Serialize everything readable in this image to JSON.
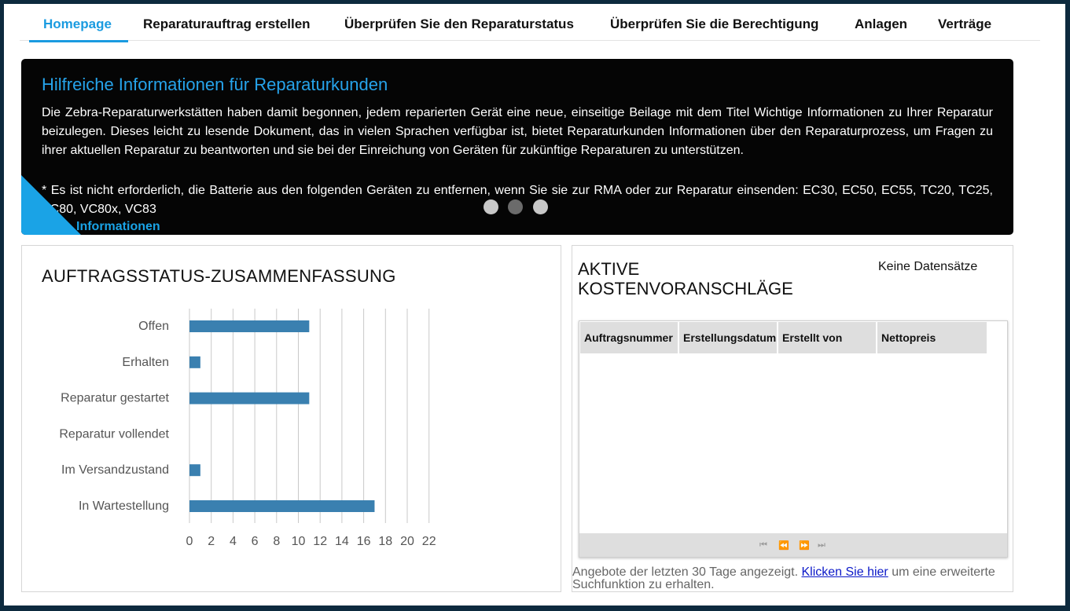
{
  "nav": {
    "items": [
      {
        "label": "Homepage",
        "active": true
      },
      {
        "label": "Reparaturauftrag erstellen"
      },
      {
        "label": "Überprüfen Sie den Reparaturstatus"
      },
      {
        "label": "Überprüfen Sie die Berechtigung"
      },
      {
        "label": "Anlagen"
      },
      {
        "label": "Verträge"
      }
    ]
  },
  "banner": {
    "title": "Hilfreiche Informationen für Reparaturkunden",
    "text": "Die Zebra-Reparaturwerkstätten haben damit begonnen, jedem reparierten Gerät eine neue, einseitige Beilage mit dem Titel Wichtige Informationen zu Ihrer Reparatur beizulegen. Dieses leicht zu lesende Dokument, das in vielen Sprachen verfügbar ist, bietet Reparaturkunden Informationen über den Reparaturprozess, um Fragen zu ihrer aktuellen Reparatur zu beantworten und sie bei der Einreichung von Geräten für zukünftige Reparaturen zu unterstützen.",
    "note": "* Es ist nicht erforderlich, die Batterie aus den folgenden Geräten zu entfernen, wenn Sie sie zur RMA oder zur Reparatur einsenden: EC30, EC50, EC55, TC20, TC25, VC80, VC80x, VC83",
    "more_link": "Informationen",
    "slides": 3,
    "active_slide": 2
  },
  "order_status": {
    "title": "AUFTRAGSSTATUS-ZUSAMMENFASSUNG"
  },
  "chart_data": {
    "type": "bar",
    "orientation": "horizontal",
    "title": "AUFTRAGSSTATUS-ZUSAMMENFASSUNG",
    "categories": [
      "Offen",
      "Erhalten",
      "Reparatur gestartet",
      "Reparatur vollendet",
      "Im Versandzustand",
      "In Wartestellung"
    ],
    "values": [
      11,
      1,
      11,
      0,
      1,
      17
    ],
    "xticks": [
      0,
      2,
      4,
      6,
      8,
      10,
      12,
      14,
      16,
      18,
      20,
      22
    ],
    "xlim": [
      0,
      22
    ],
    "grid": true,
    "bar_color": "#3a80b0"
  },
  "quotes": {
    "title_line1": "AKTIVE",
    "title_line2": "KOSTENVORANSCHLÄGE",
    "no_records": "Keine Datensätze",
    "columns": [
      "Auftragsnummer",
      "Erstellungsdatum",
      "Erstellt von",
      "Nettopreis"
    ],
    "pager_icons": [
      "first-page-icon",
      "prev-page-icon",
      "next-page-icon",
      "last-page-icon"
    ],
    "footer_text_before": "Angebote der letzten 30 Tage angezeigt. ",
    "footer_link": "Klicken Sie hier",
    "footer_text_after": " um eine erweiterte Suchfunktion zu erhalten."
  }
}
